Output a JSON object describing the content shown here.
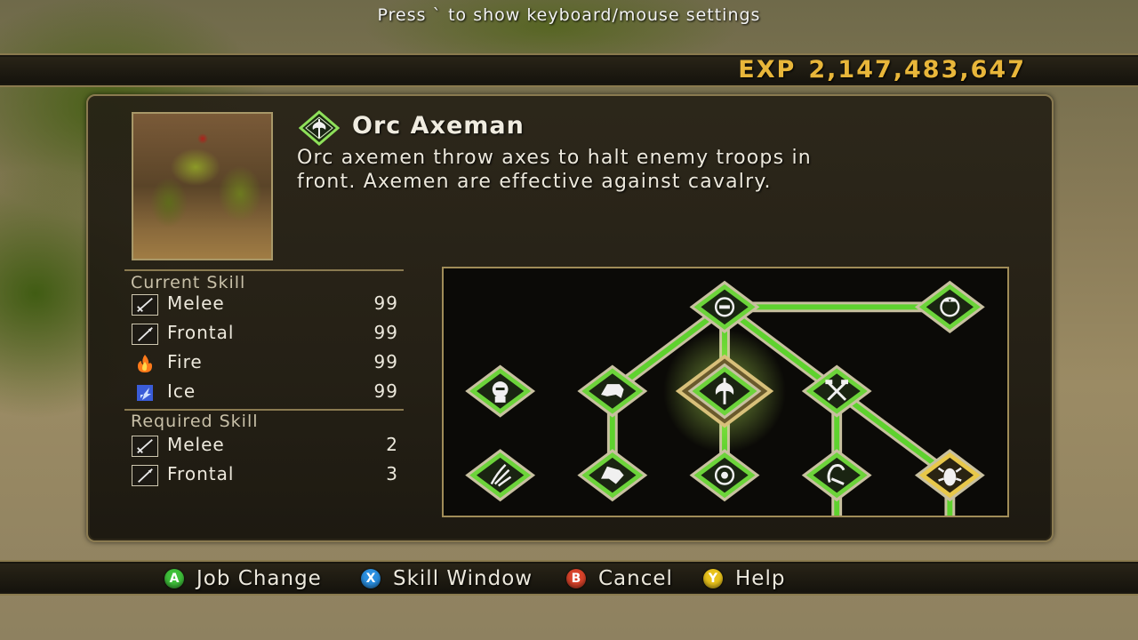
{
  "hint": "Press ` to show keyboard/mouse settings",
  "exp": {
    "label": "EXP",
    "value": "2,147,483,647"
  },
  "unit": {
    "name": "Orc Axeman",
    "icon": "axe-icon",
    "description_line1": "Orc axemen throw axes to halt enemy troops in",
    "description_line2": "front. Axemen are effective against cavalry."
  },
  "current_skill": {
    "heading": "Current Skill",
    "items": [
      {
        "name": "Melee",
        "value": "99",
        "icon": "sword-icon"
      },
      {
        "name": "Frontal",
        "value": "99",
        "icon": "spear-icon"
      },
      {
        "name": "Fire",
        "value": "99",
        "icon": "fire-icon"
      },
      {
        "name": "Ice",
        "value": "99",
        "icon": "ice-icon"
      }
    ]
  },
  "required_skill": {
    "heading": "Required Skill",
    "items": [
      {
        "name": "Melee",
        "value": "2",
        "icon": "sword-icon"
      },
      {
        "name": "Frontal",
        "value": "3",
        "icon": "spear-icon"
      }
    ]
  },
  "footer": {
    "buttons": [
      {
        "key": "A",
        "label": "Job Change",
        "color": "#3fbf3a"
      },
      {
        "key": "X",
        "label": "Skill Window",
        "color": "#2a8fe0"
      },
      {
        "key": "B",
        "label": "Cancel",
        "color": "#d8432a"
      },
      {
        "key": "Y",
        "label": "Help",
        "color": "#e8c21c"
      }
    ]
  },
  "colors": {
    "accent": "#e8b63a",
    "node_green": "#7fdc3a",
    "node_gold": "#d8b848"
  }
}
